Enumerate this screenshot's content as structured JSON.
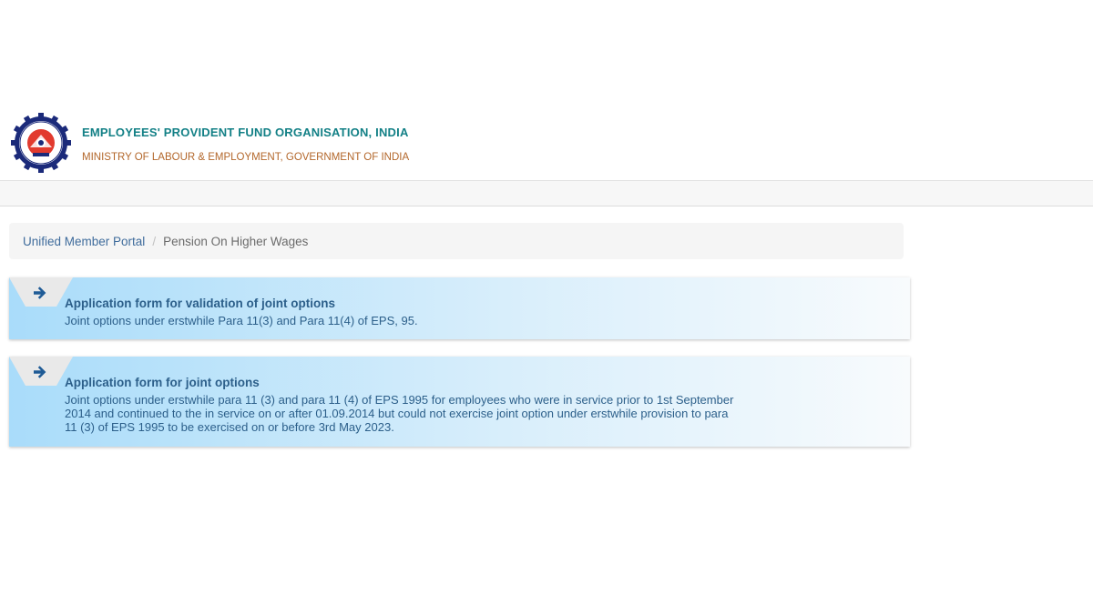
{
  "header": {
    "org_name": "EMPLOYEES' PROVIDENT FUND ORGANISATION, INDIA",
    "ministry": "MINISTRY OF LABOUR & EMPLOYMENT, GOVERNMENT OF INDIA",
    "logo_icon": "epfo-emblem-icon"
  },
  "breadcrumb": {
    "home": "Unified Member Portal",
    "separator": "/",
    "current": "Pension On Higher Wages"
  },
  "cards": [
    {
      "title": "Application form for validation of joint options",
      "description": "Joint options under erstwhile Para 11(3) and Para 11(4) of EPS, 95.",
      "icon": "arrow-right-icon"
    },
    {
      "title": "Application form for joint options",
      "description": "Joint options under erstwhile para 11 (3) and para 11 (4) of EPS 1995 for employees who were in service prior to 1st September 2014 and continued to the in service on or after 01.09.2014 but could not exercise joint option under erstwhile provision to para 11 (3) of EPS 1995 to be exercised on or before 3rd May 2023.",
      "icon": "arrow-right-icon"
    }
  ],
  "colors": {
    "brand_teal": "#138086",
    "ministry_orange": "#b3672b",
    "link_blue": "#3f6c9c",
    "card_text": "#2c5f8a",
    "arrow_blue": "#1f5b96"
  }
}
